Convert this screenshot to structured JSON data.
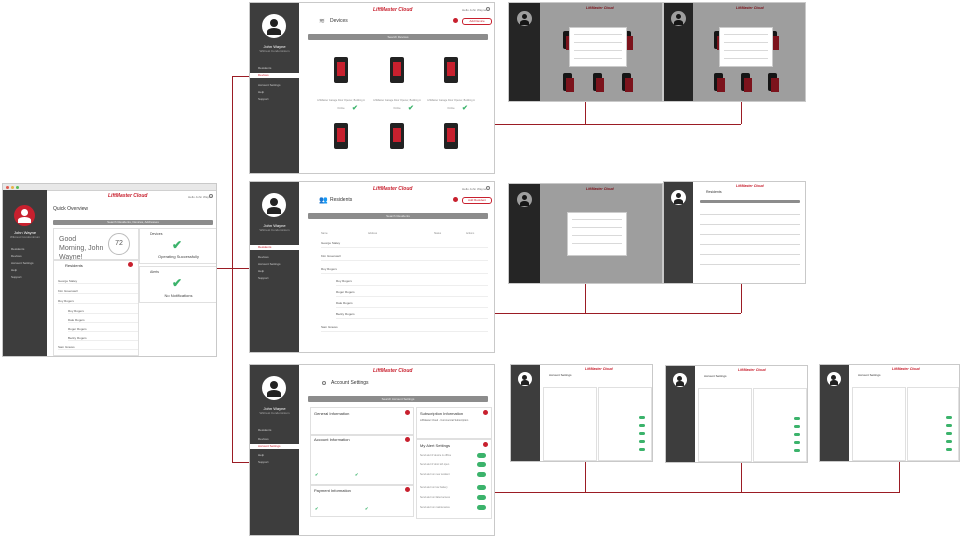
{
  "user": {
    "name": "John Wayne",
    "subtitle": "Wilcrest Condominium"
  },
  "brand": "LiftMaster Cloud",
  "topbar_user": "Hello John Wayne",
  "nav": {
    "residents": "Residents",
    "devices": "Devices",
    "account_settings": "Account Settings",
    "help": "Help",
    "support": "Support"
  },
  "overview": {
    "title": "Quick Overview",
    "search": "Search Residents, Devices, Addresses",
    "greeting": "Good Morning, John Wayne!",
    "temperature": "72",
    "devices_label": "Devices",
    "devices_status": "Operating Successfully",
    "residents_label": "Residents",
    "alerts_label": "Alerts",
    "alerts_status": "No Notifications",
    "resident_rows": [
      "George Staley",
      "Kim Greenwell",
      "Roy Rogers",
      "Roy Rogers",
      "Dale Rogers",
      "Roger Rogers",
      "Becky Rogers",
      "Sam Graves"
    ]
  },
  "devices": {
    "title": "Devices",
    "search": "Search Devices",
    "add_button": "Add Device",
    "caption": "LiftMaster Garage Door Opener, Building A",
    "status": "Online"
  },
  "residents": {
    "title": "Residents",
    "search": "Search Residents",
    "add_button": "Add Resident",
    "columns": [
      "Name",
      "Address",
      "Status",
      "Actions"
    ],
    "rows": [
      "George Staley",
      "Kim Greenwell",
      "Roy Rogers",
      "Roy Rogers",
      "Roger Rogers",
      "Dale Rogers",
      "Becky Rogers",
      "Sam Graves"
    ]
  },
  "account": {
    "title": "Account Settings",
    "search": "Search Account Settings",
    "general": "General Information",
    "account_info": "Account Information",
    "payment": "Payment Information",
    "subscription": "Subscription Information",
    "subscription_value": "LiftMaster Cloud - Commercial Subscription",
    "alerts": "My Alert Settings",
    "alert_rows": [
      "Send alert if device is offline",
      "Send alert if door left open",
      "Send alert on new resident",
      "Send alert on low battery",
      "Send alert on failed access",
      "Send alert on maintenance"
    ]
  },
  "colors": {
    "brand": "#c8202e",
    "sidebar": "#3d3d3d",
    "ok": "#3bb36b",
    "connector": "#9b1c24"
  }
}
